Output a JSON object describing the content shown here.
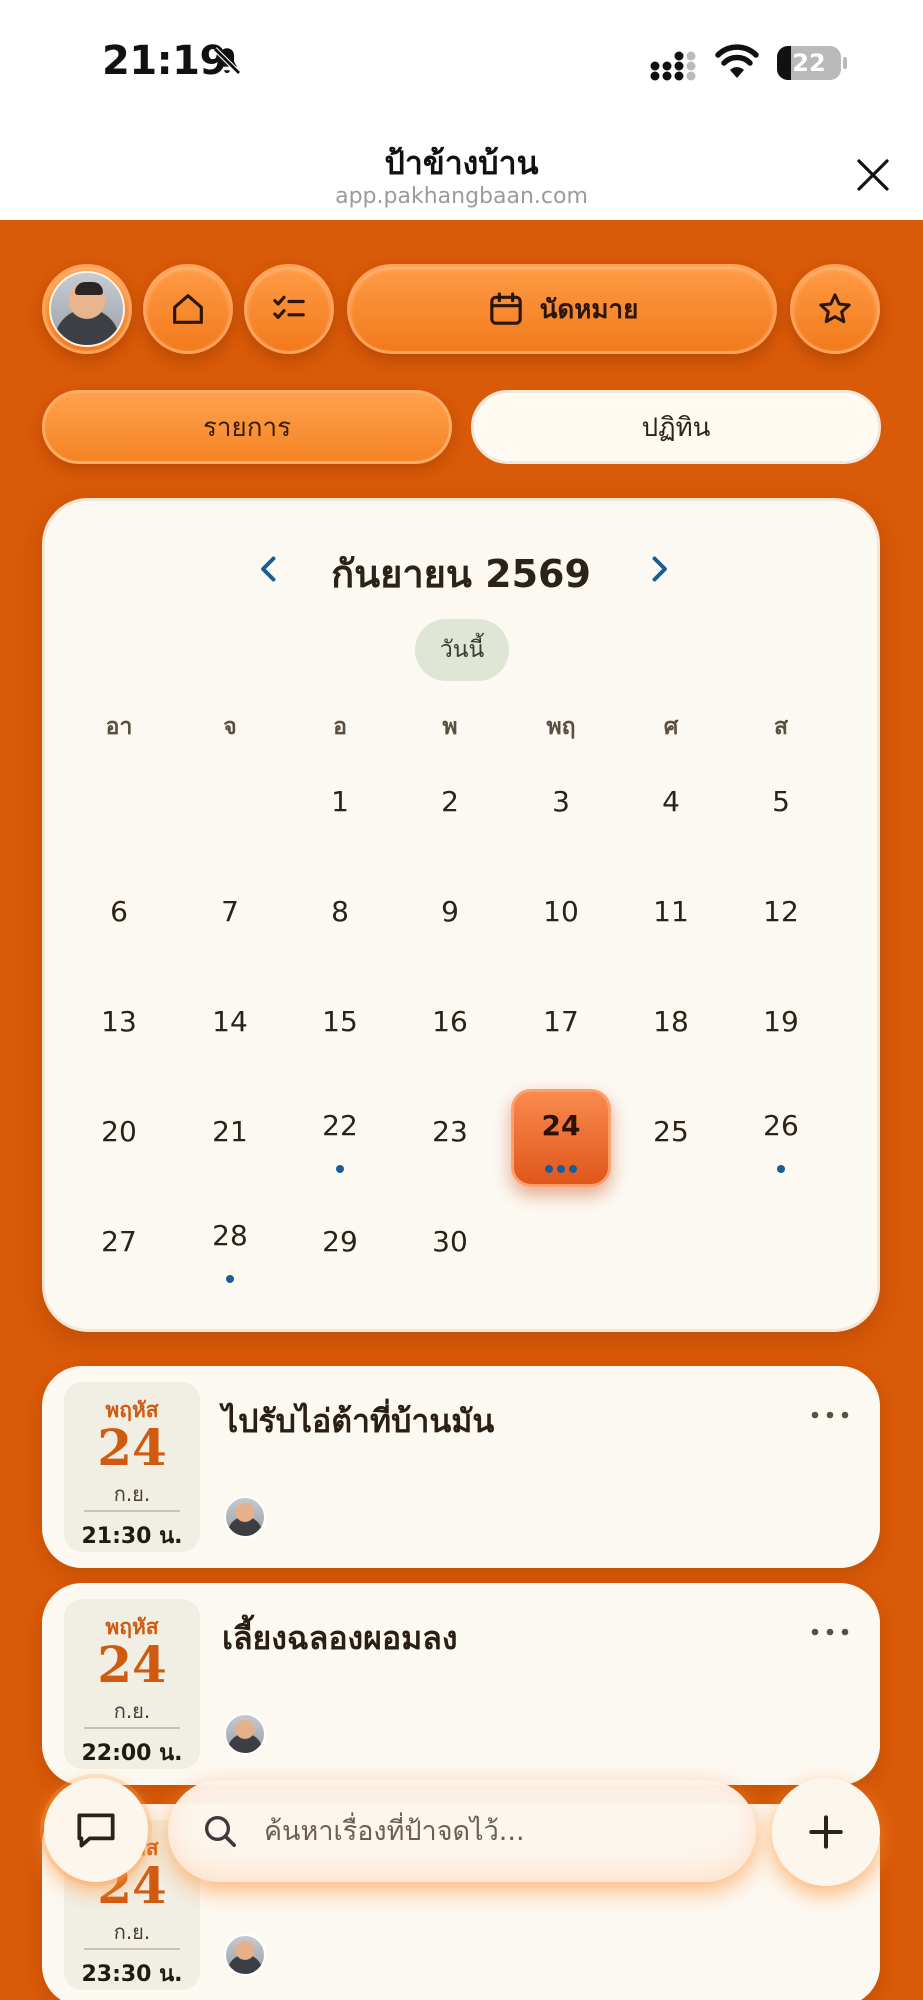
{
  "status_bar": {
    "time": "21:19",
    "battery": "22",
    "battery_level": 0.22
  },
  "header": {
    "title": "ป้าข้างบ้าน",
    "url": "app.pakhangbaan.com"
  },
  "toolbar": {
    "appointments_label": "นัดหมาย"
  },
  "tabs": {
    "list_label": "รายการ",
    "calendar_label": "ปฏิทิน"
  },
  "calendar": {
    "month_title": "กันยายน 2569",
    "today_label": "วันนี้",
    "weekdays": [
      "อา",
      "จ",
      "อ",
      "พ",
      "พฤ",
      "ศ",
      "ส"
    ],
    "first_weekday_index": 2,
    "days_in_month": 30,
    "selected_day": 24,
    "event_dots": {
      "22": 1,
      "24": 3,
      "26": 1,
      "28": 1
    }
  },
  "events": [
    {
      "dow": "พฤหัส",
      "day": "24",
      "month": "ก.ย.",
      "time": "21:30 น.",
      "title": "ไปรับไอ่ต้าที่บ้านมัน"
    },
    {
      "dow": "พฤหัส",
      "day": "24",
      "month": "ก.ย.",
      "time": "22:00 น.",
      "title": "เลี้ยงฉลองผอมลง"
    },
    {
      "dow": "พฤหัส",
      "day": "24",
      "month": "ก.ย.",
      "time": "23:30 น.",
      "title": ""
    }
  ],
  "search": {
    "placeholder": "ค้นหาเรื่องที่ป้าจดไว้..."
  },
  "colors": {
    "background": "#d95a08",
    "accent": "#f27a1c",
    "event_dot": "#1a5c96",
    "date_accent": "#d05a10"
  },
  "icons": {
    "bell": "bell-off-icon",
    "home": "home-icon",
    "tasks": "checklist-icon",
    "calendar": "calendar-icon",
    "star": "star-icon",
    "chat": "chat-icon",
    "search": "search-icon",
    "add": "plus-icon",
    "close": "close-icon",
    "more": "more-dots-icon"
  }
}
